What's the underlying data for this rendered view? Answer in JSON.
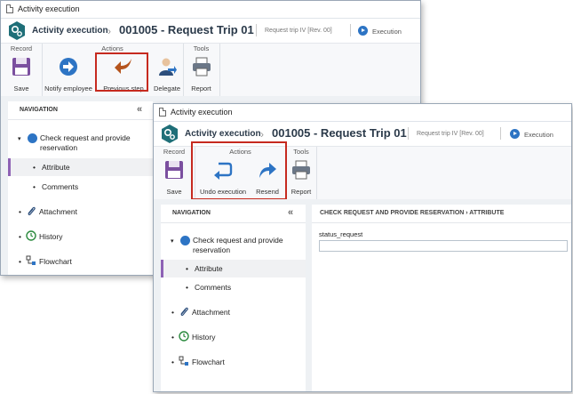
{
  "win1": {
    "window_title": "Activity execution",
    "header": {
      "name": "Activity execution",
      "record_title": "001005 - Request Trip 01",
      "process": "Request trip IV [Rev. 00]",
      "status": "Execution"
    },
    "ribbon": {
      "groups": {
        "record": "Record",
        "actions": "Actions",
        "tools": "Tools"
      },
      "buttons": {
        "save": "Save",
        "notify": "Notify employee",
        "previous": "Previous step",
        "delegate": "Delegate",
        "report": "Report"
      }
    },
    "nav": {
      "title": "NAVIGATION",
      "items": {
        "check": "Check request and provide reservation",
        "attribute": "Attribute",
        "comments": "Comments",
        "attachment": "Attachment",
        "history": "History",
        "flowchart": "Flowchart"
      }
    }
  },
  "win2": {
    "window_title": "Activity execution",
    "header": {
      "name": "Activity execution",
      "record_title": "001005 - Request Trip 01",
      "process": "Request trip IV [Rev. 00]",
      "status": "Execution"
    },
    "ribbon": {
      "groups": {
        "record": "Record",
        "actions": "Actions",
        "tools": "Tools"
      },
      "buttons": {
        "save": "Save",
        "undo": "Undo execution",
        "resend": "Resend",
        "report": "Report"
      }
    },
    "nav": {
      "title": "NAVIGATION",
      "items": {
        "check": "Check request and provide reservation",
        "attribute": "Attribute",
        "comments": "Comments",
        "attachment": "Attachment",
        "history": "History",
        "flowchart": "Flowchart"
      }
    },
    "detail": {
      "breadcrumb": "CHECK REQUEST AND PROVIDE RESERVATION  ›  ATTRIBUTE",
      "field_label": "status_request",
      "field_value": ""
    }
  },
  "colors": {
    "highlight": "#c62a1f",
    "accent_blue": "#2d74c4",
    "logo_teal": "#1f6f78",
    "selected_bar": "#8e62b5",
    "previous_arrow": "#b5541d"
  }
}
